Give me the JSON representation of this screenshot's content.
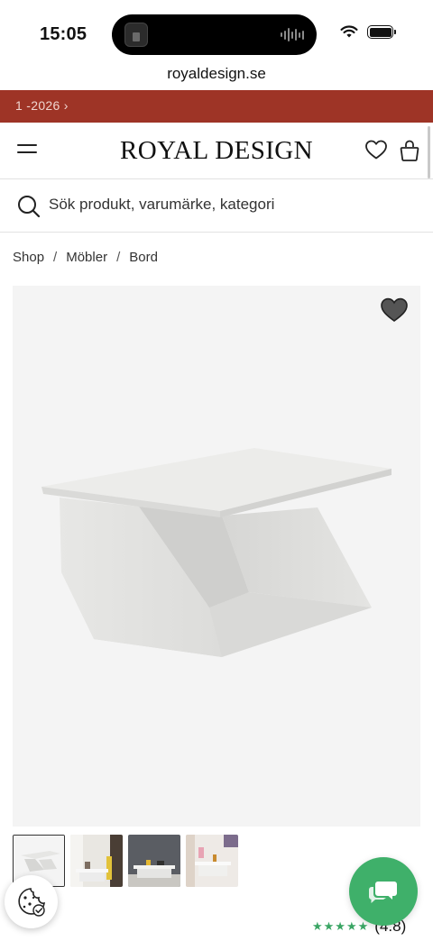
{
  "status_bar": {
    "time": "15:05"
  },
  "browser": {
    "url": "royaldesign.se"
  },
  "promo": {
    "text": "1 -2026 ›"
  },
  "header": {
    "logo": "ROYAL DESIGN"
  },
  "search": {
    "placeholder": "Sök produkt, varumärke, kategori"
  },
  "breadcrumb": [
    "Shop",
    "Möbler",
    "Bord"
  ],
  "breadcrumb_separator": "/",
  "product": {
    "rating": "(4.8)",
    "rating_stars": "★★★★★",
    "thumbnail_count": 4
  },
  "icons": {
    "menu": "menu-icon",
    "wishlist": "heart-icon",
    "cart": "shopping-bag-icon",
    "search": "search-icon",
    "cookie": "cookie-icon",
    "chat": "chat-icon"
  },
  "colors": {
    "promo_background": "#9e3426",
    "chat_button": "#3fb06a",
    "rating_stars": "#3aa564"
  }
}
